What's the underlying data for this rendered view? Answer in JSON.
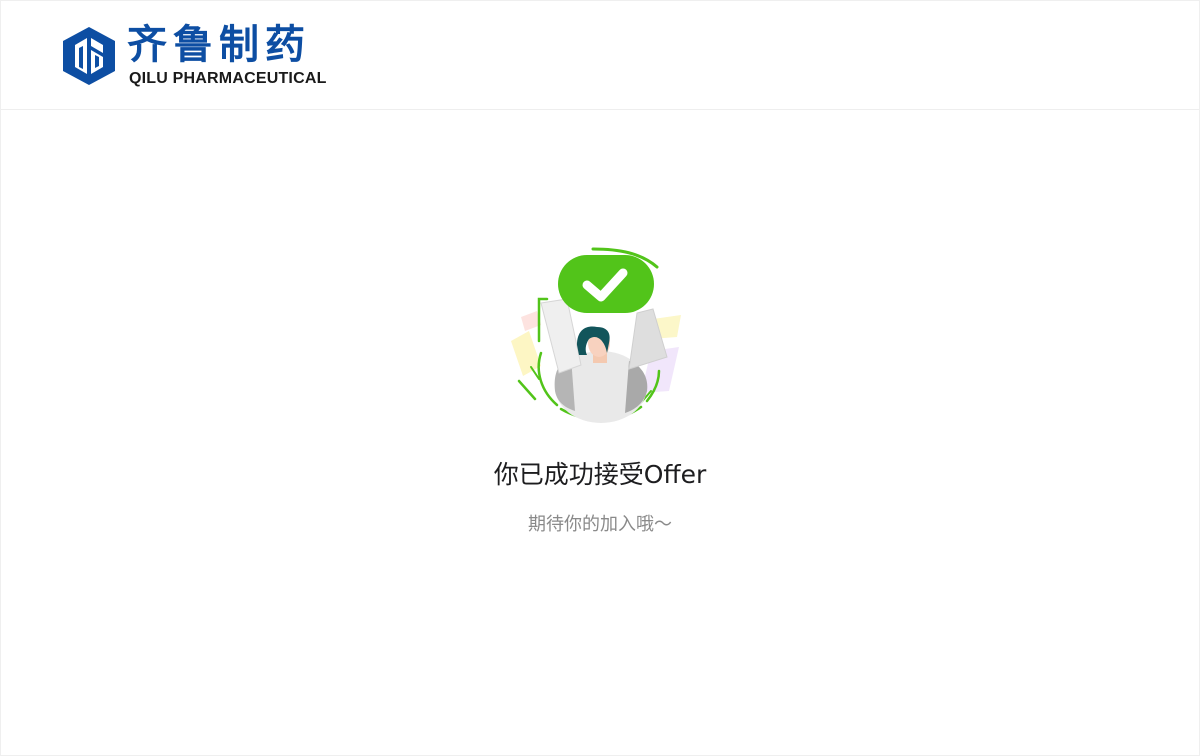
{
  "header": {
    "logo_cn": "齐鲁制药",
    "logo_en": "QILU PHARMACEUTICAL"
  },
  "result": {
    "title": "你已成功接受Offer",
    "subtitle": "期待你的加入哦～",
    "illustration_icon": "check-icon"
  },
  "colors": {
    "brand_blue": "#0d4ea3",
    "success_green": "#52c41a",
    "title_text": "#1d1d1f",
    "subtitle_text": "#8a8a8a"
  }
}
